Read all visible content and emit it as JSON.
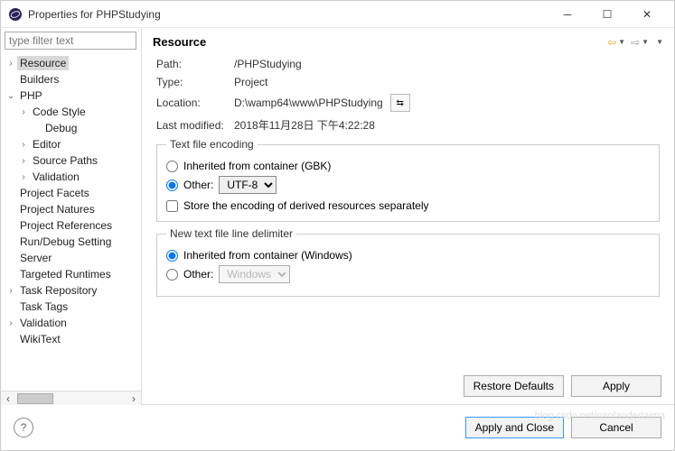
{
  "window": {
    "title": "Properties for PHPStudying"
  },
  "filter_placeholder": "type filter text",
  "tree": [
    {
      "label": "Resource",
      "arrow": "›",
      "indent": 0,
      "selected": true
    },
    {
      "label": "Builders",
      "arrow": "",
      "indent": 0
    },
    {
      "label": "PHP",
      "arrow": "⌄",
      "indent": 0
    },
    {
      "label": "Code Style",
      "arrow": "›",
      "indent": 1
    },
    {
      "label": "Debug",
      "arrow": "",
      "indent": 2
    },
    {
      "label": "Editor",
      "arrow": "›",
      "indent": 1
    },
    {
      "label": "Source Paths",
      "arrow": "›",
      "indent": 1
    },
    {
      "label": "Validation",
      "arrow": "›",
      "indent": 1
    },
    {
      "label": "Project Facets",
      "arrow": "",
      "indent": 0
    },
    {
      "label": "Project Natures",
      "arrow": "",
      "indent": 0
    },
    {
      "label": "Project References",
      "arrow": "",
      "indent": 0
    },
    {
      "label": "Run/Debug Setting",
      "arrow": "",
      "indent": 0
    },
    {
      "label": "Server",
      "arrow": "",
      "indent": 0
    },
    {
      "label": "Targeted Runtimes",
      "arrow": "",
      "indent": 0
    },
    {
      "label": "Task Repository",
      "arrow": "›",
      "indent": 0
    },
    {
      "label": "Task Tags",
      "arrow": "",
      "indent": 0
    },
    {
      "label": "Validation",
      "arrow": "›",
      "indent": 0
    },
    {
      "label": "WikiText",
      "arrow": "",
      "indent": 0
    }
  ],
  "header": {
    "title": "Resource"
  },
  "props": {
    "path_label": "Path:",
    "path_value": "/PHPStudying",
    "type_label": "Type:",
    "type_value": "Project",
    "location_label": "Location:",
    "location_value": "D:\\wamp64\\www\\PHPStudying",
    "lastmod_label": "Last modified:",
    "lastmod_value": "2018年11月28日 下午4:22:28"
  },
  "encoding": {
    "legend": "Text file encoding",
    "inherited_label": "Inherited from container (GBK)",
    "other_label": "Other:",
    "other_value": "UTF-8",
    "store_label": "Store the encoding of derived resources separately"
  },
  "delimiter": {
    "legend": "New text file line delimiter",
    "inherited_label": "Inherited from container (Windows)",
    "other_label": "Other:",
    "other_value": "Windows"
  },
  "buttons": {
    "restore": "Restore Defaults",
    "apply": "Apply",
    "apply_close": "Apply and Close",
    "cancel": "Cancel"
  },
  "watermark": "blog.csdn.net/naofandedaima"
}
